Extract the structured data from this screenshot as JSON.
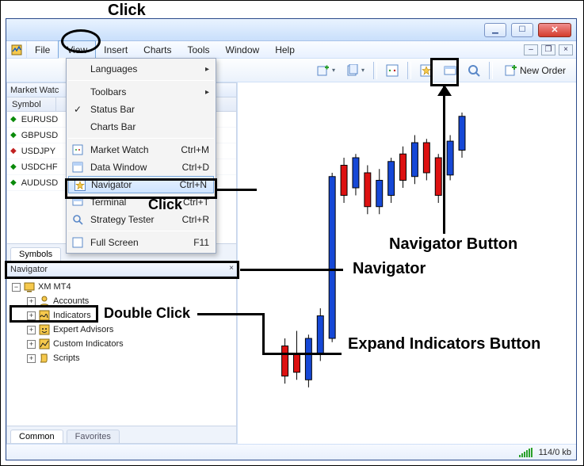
{
  "window": {
    "minimize": "minimize",
    "maximize": "maximize",
    "close": "close"
  },
  "menubar": {
    "items": [
      "File",
      "View",
      "Insert",
      "Charts",
      "Tools",
      "Window",
      "Help"
    ],
    "open_index": 1,
    "mdi": {
      "min": "–",
      "restore": "❐",
      "close": "×"
    }
  },
  "toolbar": {
    "new_order_label": "New Order"
  },
  "market_watch": {
    "title": "Market Watc",
    "col0": "Symbol",
    "symbols": [
      {
        "name": "EURUSD",
        "dir": "up"
      },
      {
        "name": "GBPUSD",
        "dir": "up"
      },
      {
        "name": "USDJPY",
        "dir": "down"
      },
      {
        "name": "USDCHF",
        "dir": "up"
      },
      {
        "name": "AUDUSD",
        "dir": "up"
      }
    ],
    "tabs": [
      "Symbols"
    ]
  },
  "navigator": {
    "title": "Navigator",
    "root": "XM MT4",
    "nodes": [
      {
        "label": "Accounts",
        "icon": "accounts"
      },
      {
        "label": "Indicators",
        "icon": "indicators"
      },
      {
        "label": "Expert Advisors",
        "icon": "experts"
      },
      {
        "label": "Custom Indicators",
        "icon": "custom"
      },
      {
        "label": "Scripts",
        "icon": "scripts"
      }
    ],
    "tabs": [
      "Common",
      "Favorites"
    ]
  },
  "view_menu": {
    "languages": "Languages",
    "toolbars": "Toolbars",
    "status_bar": "Status Bar",
    "charts_bar": "Charts Bar",
    "market_watch": {
      "label": "Market Watch",
      "sc": "Ctrl+M"
    },
    "data_window": {
      "label": "Data Window",
      "sc": "Ctrl+D"
    },
    "navigator": {
      "label": "Navigator",
      "sc": "Ctrl+N"
    },
    "terminal": {
      "label": "Terminal",
      "sc": "Ctrl+T"
    },
    "strategy": {
      "label": "Strategy Tester",
      "sc": "Ctrl+R"
    },
    "full_screen": {
      "label": "Full Screen",
      "sc": "F11"
    }
  },
  "statusbar": {
    "text": "114/0 kb"
  },
  "annotations": {
    "click_top": "Click",
    "click_nav": "Click",
    "double_click": "Double Click",
    "navigator_button": "Navigator Button",
    "navigator": "Navigator",
    "expand_indicators": "Expand Indicators Button"
  }
}
